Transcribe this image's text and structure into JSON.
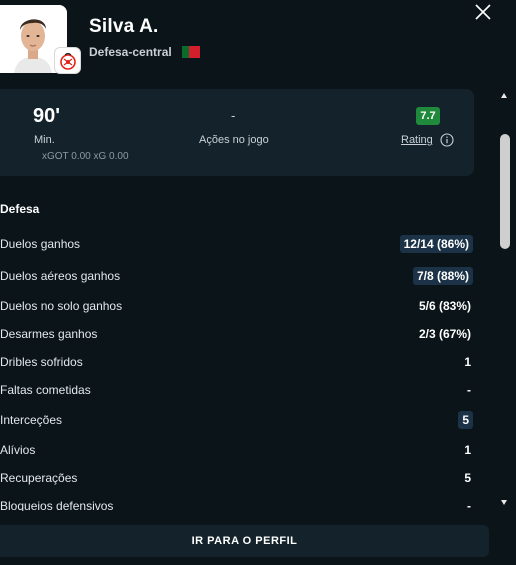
{
  "player": {
    "name": "Silva A.",
    "position": "Defesa-central",
    "nationality_flag": "portugal-flag",
    "club_badge": "benfica-crest",
    "colors": {
      "flag_green": "#0b6b2a",
      "flag_red": "#d21f2b",
      "club_red": "#e2231a"
    }
  },
  "summary": {
    "minutes_value": "90'",
    "minutes_label": "Min.",
    "actions_value": "-",
    "actions_label": "Ações no jogo",
    "rating_value": "7.7",
    "rating_label": "Rating",
    "rating_color": "#1f8a3b",
    "xg_line": "xGOT 0.00   xG 0.00"
  },
  "section": {
    "title": "Defesa"
  },
  "stats": [
    {
      "label": "Duelos ganhos",
      "value": "12/14 (86%)",
      "highlight": true
    },
    {
      "label": "Duelos aéreos ganhos",
      "value": "7/8 (88%)",
      "highlight": true
    },
    {
      "label": "Duelos no solo ganhos",
      "value": "5/6 (83%)",
      "highlight": false
    },
    {
      "label": "Desarmes ganhos",
      "value": "2/3 (67%)",
      "highlight": false
    },
    {
      "label": "Dribles sofridos",
      "value": "1",
      "highlight": false
    },
    {
      "label": "Faltas cometidas",
      "value": "-",
      "highlight": false
    },
    {
      "label": "Interceções",
      "value": "5",
      "highlight": true
    },
    {
      "label": "Alívios",
      "value": "1",
      "highlight": false
    },
    {
      "label": "Recuperações",
      "value": "5",
      "highlight": false
    },
    {
      "label": "Bloqueios defensivos",
      "value": "-",
      "highlight": false
    }
  ],
  "footer": {
    "profile_button_label": "IR PARA O PERFIL"
  },
  "icons": {
    "close": "close-icon",
    "info": "info-icon"
  }
}
